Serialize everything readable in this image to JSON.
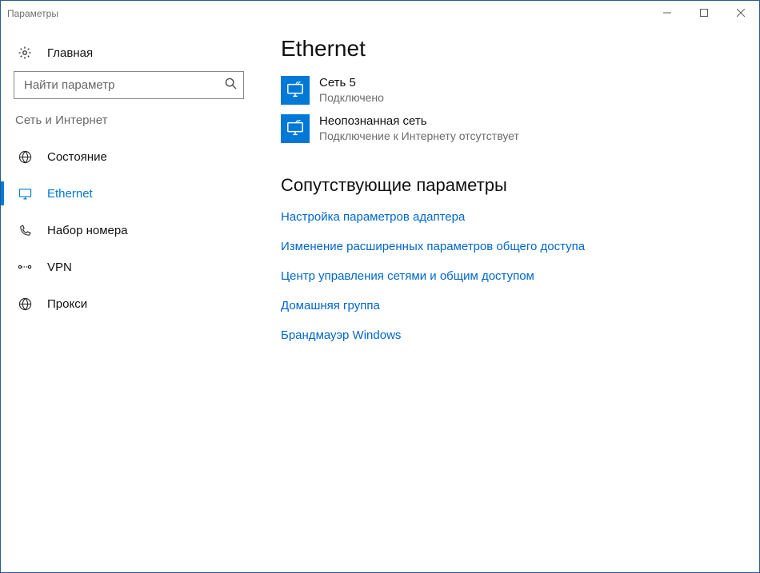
{
  "window": {
    "title": "Параметры"
  },
  "sidebar": {
    "home_label": "Главная",
    "search_placeholder": "Найти параметр",
    "section_label": "Сеть и Интернет",
    "items": [
      {
        "id": "status",
        "label": "Состояние",
        "active": false
      },
      {
        "id": "ethernet",
        "label": "Ethernet",
        "active": true
      },
      {
        "id": "dialup",
        "label": "Набор номера",
        "active": false
      },
      {
        "id": "vpn",
        "label": "VPN",
        "active": false
      },
      {
        "id": "proxy",
        "label": "Прокси",
        "active": false
      }
    ]
  },
  "main": {
    "heading": "Ethernet",
    "connections": [
      {
        "name": "Сеть  5",
        "status": "Подключено"
      },
      {
        "name": "Неопознанная сеть",
        "status": "Подключение к Интернету отсутствует"
      }
    ],
    "related_heading": "Сопутствующие параметры",
    "related_links": [
      "Настройка параметров адаптера",
      "Изменение расширенных параметров общего доступа",
      "Центр управления сетями и общим доступом",
      "Домашняя группа",
      "Брандмауэр Windows"
    ]
  }
}
